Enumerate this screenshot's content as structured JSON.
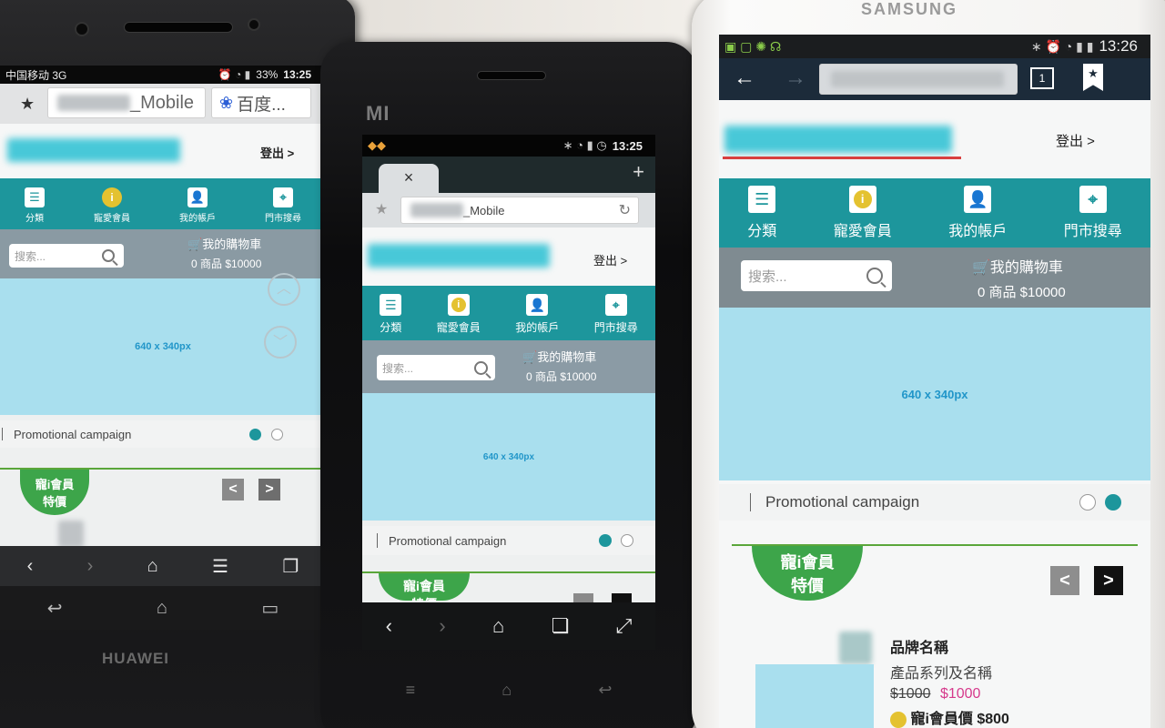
{
  "devices": {
    "left": {
      "brand": "HUAWEI",
      "status": {
        "carrier": "中国移动 3G",
        "battery": "33%",
        "time": "13:25"
      },
      "browser": {
        "url_suffix": "_Mobile",
        "search_engine": "百度..."
      },
      "site": {
        "logout": "登出 >",
        "nav": [
          {
            "label": "分類",
            "icon": "list-icon"
          },
          {
            "label": "寵愛會員",
            "icon": "info-icon"
          },
          {
            "label": "我的帳戶",
            "icon": "user-icon"
          },
          {
            "label": "門市搜尋",
            "icon": "location-icon"
          }
        ],
        "search_placeholder": "搜索...",
        "cart_label": "我的購物車",
        "cart_summary": "0 商品 $10000",
        "banner": "640 x 340px",
        "promo": "Promotional campaign",
        "vip": [
          "寵i會員",
          "特價"
        ]
      }
    },
    "middle": {
      "brand": "MI",
      "status": {
        "time": "13:25"
      },
      "browser": {
        "url_suffix": "_Mobile",
        "tab_close": "×",
        "new_tab": "+"
      },
      "site": {
        "logout": "登出 >",
        "nav": [
          {
            "label": "分類",
            "icon": "list-icon"
          },
          {
            "label": "寵愛會員",
            "icon": "info-icon"
          },
          {
            "label": "我的帳戶",
            "icon": "user-icon"
          },
          {
            "label": "門市搜尋",
            "icon": "location-icon"
          }
        ],
        "search_placeholder": "搜索...",
        "cart_label": "我的購物車",
        "cart_summary": "0 商品 $10000",
        "banner": "640 x 340px",
        "promo": "Promotional campaign",
        "vip": [
          "寵i會員",
          "特價"
        ]
      }
    },
    "right": {
      "brand": "SAMSUNG",
      "status": {
        "time": "13:26"
      },
      "browser": {
        "tabs_count": "1"
      },
      "site": {
        "logout": "登出 >",
        "nav": [
          {
            "label": "分類",
            "icon": "list-icon"
          },
          {
            "label": "寵愛會員",
            "icon": "info-icon"
          },
          {
            "label": "我的帳戶",
            "icon": "user-icon"
          },
          {
            "label": "門市搜尋",
            "icon": "location-icon"
          }
        ],
        "search_placeholder": "搜索...",
        "cart_label": "我的購物車",
        "cart_summary": "0 商品 $10000",
        "banner": "640 x 340px",
        "promo": "Promotional campaign",
        "vip": [
          "寵i會員",
          "特價"
        ],
        "product": {
          "brand_name": "品牌名稱",
          "series": "產品系列及名稱",
          "old_price": "$1000",
          "price": "$1000",
          "member_price": "寵i會員價 $800"
        }
      }
    }
  },
  "colors": {
    "teal": "#1d969c",
    "banner": "#a9dfee",
    "green": "#3da54a",
    "price": "#d63a8c"
  }
}
